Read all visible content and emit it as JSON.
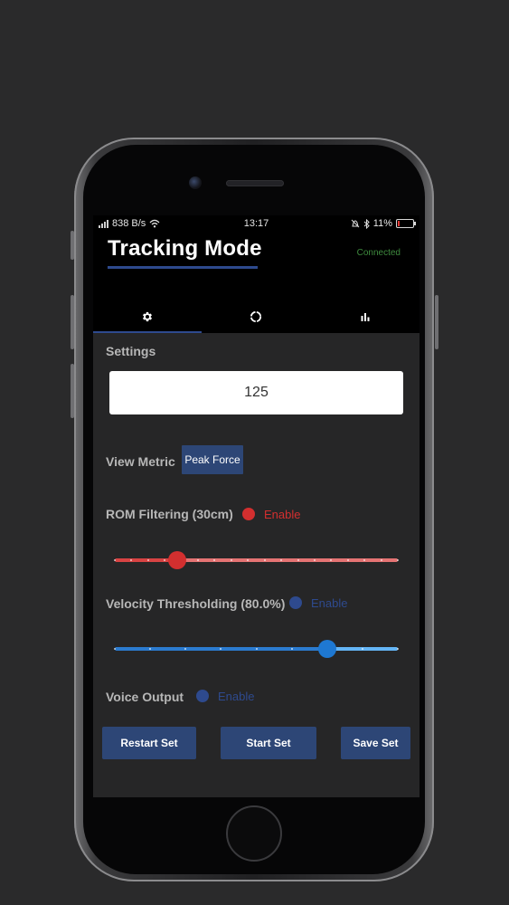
{
  "statusbar": {
    "net_speed": "838 B/s",
    "time": "13:17",
    "battery": "11%",
    "battery_level": 0.11
  },
  "header": {
    "title": "Tracking Mode",
    "connection": "Connected"
  },
  "tabs": [
    {
      "icon": "gear-icon",
      "active": true
    },
    {
      "icon": "circle-progress-icon",
      "active": false
    },
    {
      "icon": "bar-chart-icon",
      "active": false
    }
  ],
  "settings": {
    "label": "Settings",
    "value": "125"
  },
  "view_metric": {
    "label": "View Metric",
    "button": "Peak Force"
  },
  "rom_filtering": {
    "label": "ROM Filtering (30cm)",
    "enable": "Enable",
    "color": "#d32f2f",
    "slider_fraction": 0.22
  },
  "velocity_thresholding": {
    "label": "Velocity Thresholding (80.0%)",
    "enable": "Enable",
    "color": "#2e4a8e",
    "slider_fraction": 0.75
  },
  "voice_output": {
    "label": "Voice Output",
    "enable": "Enable",
    "color": "#2e4a8e"
  },
  "actions": {
    "restart": "Restart Set",
    "start": "Start Set",
    "save": "Save Set"
  }
}
